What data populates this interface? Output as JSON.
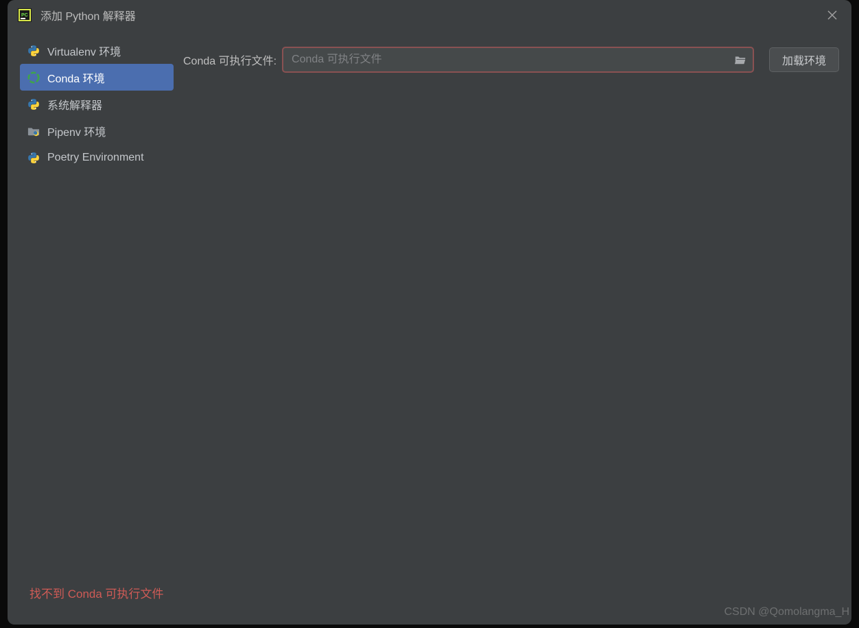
{
  "window": {
    "title": "添加 Python 解释器"
  },
  "sidebar": {
    "items": [
      {
        "label": "Virtualenv 环境",
        "icon": "python-icon"
      },
      {
        "label": "Conda 环境",
        "icon": "conda-icon"
      },
      {
        "label": "系统解释器",
        "icon": "python-icon"
      },
      {
        "label": "Pipenv 环境",
        "icon": "folder-python-icon"
      },
      {
        "label": "Poetry Environment",
        "icon": "python-icon"
      }
    ],
    "selected_index": 1
  },
  "form": {
    "conda_exe_label": "Conda 可执行文件:",
    "conda_exe_placeholder": "Conda 可执行文件",
    "conda_exe_value": "",
    "load_env_button": "加载环境"
  },
  "error": {
    "message": "找不到 Conda 可执行文件"
  },
  "watermark": "CSDN @Qomolangma_H"
}
